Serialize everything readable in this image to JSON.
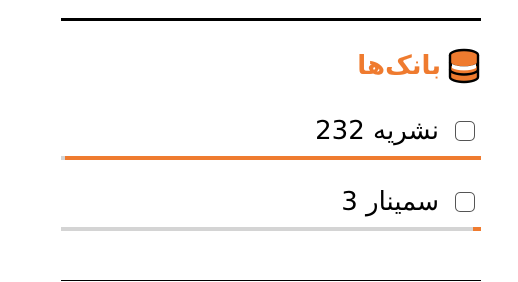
{
  "panel": {
    "title": "بانک‌ها",
    "title_icon": "database-icon",
    "accent_color": "#ef7b2f",
    "track_color": "#d4d4d4",
    "items": [
      {
        "label": "نشریه 232",
        "checked": false,
        "progress": 0.99
      },
      {
        "label": "سمینار 3",
        "checked": false,
        "progress": 0.02
      }
    ]
  }
}
